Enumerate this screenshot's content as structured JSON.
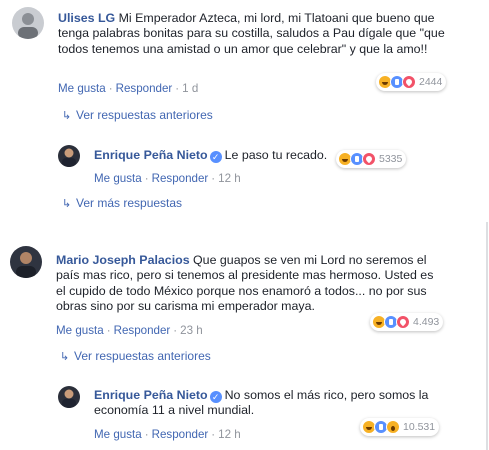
{
  "comments": [
    {
      "name": "Ulises LG",
      "text": "Mi Emperador Azteca, mi lord, mi Tlatoani que bueno que tenga palabras bonitas para su costilla, saludos a Pau dígale que \"que todos tenemos una amistad o un amor que celebrar\" y que la amo!!",
      "like_label": "Me gusta",
      "reply_label": "Responder",
      "time": "1 d",
      "reactions": [
        "haha",
        "like",
        "love"
      ],
      "reaction_count": "2444",
      "more_label": "Ver respuestas anteriores"
    },
    {
      "name": "Enrique Peña Nieto",
      "verified": true,
      "text": "Le paso tu recado.",
      "like_label": "Me gusta",
      "reply_label": "Responder",
      "time": "12 h",
      "reactions": [
        "haha",
        "like",
        "love"
      ],
      "reaction_count": "5335",
      "more_label": "Ver más respuestas"
    },
    {
      "name": "Mario Joseph Palacios",
      "text": "Que guapos se ven mi Lord no seremos el país mas rico, pero si tenemos al presidente mas hermoso. Usted es el cupido de todo México porque nos enamoró a todos... no por sus obras sino por su carisma mi emperador maya.",
      "like_label": "Me gusta",
      "reply_label": "Responder",
      "time": "23 h",
      "reactions": [
        "haha",
        "like",
        "love"
      ],
      "reaction_count": "4.493",
      "more_label": "Ver respuestas anteriores"
    },
    {
      "name": "Enrique Peña Nieto",
      "verified": true,
      "text": "No somos el más rico, pero somos la economía 11 a nivel mundial.",
      "like_label": "Me gusta",
      "reply_label": "Responder",
      "time": "12 h",
      "reactions": [
        "haha",
        "like",
        "wow"
      ],
      "reaction_count": "10.531"
    }
  ],
  "separator": "·"
}
